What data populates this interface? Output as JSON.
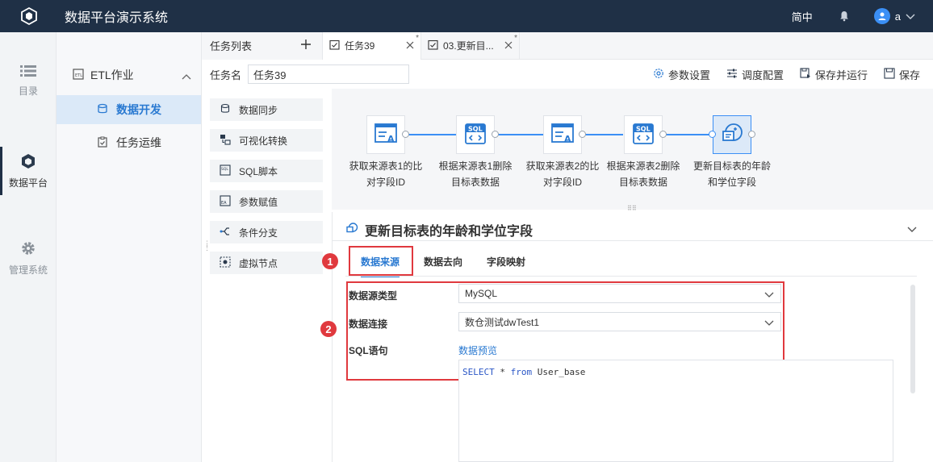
{
  "app": {
    "title": "数据平台演示系统",
    "language": "简中",
    "user": "a"
  },
  "leftnav": [
    {
      "label": "目录",
      "icon": "list-icon"
    },
    {
      "label": "数据平台",
      "icon": "cubes-icon"
    },
    {
      "label": "管理系统",
      "icon": "gear-icon"
    }
  ],
  "secondnav": {
    "group_label": "ETL作业",
    "items": [
      {
        "label": "数据开发",
        "active": true
      },
      {
        "label": "任务运维"
      }
    ]
  },
  "tabs": {
    "list_label": "任务列表",
    "items": [
      {
        "label": "任务39",
        "active": true,
        "modified": "*"
      },
      {
        "label": "03.更新目...",
        "modified": "*"
      }
    ]
  },
  "toolbar": {
    "name_label": "任务名",
    "name_value": "任务39",
    "actions": [
      "参数设置",
      "调度配置",
      "保存并运行",
      "保存"
    ]
  },
  "palette": [
    "数据同步",
    "可视化转换",
    "SQL脚本",
    "参数赋值",
    "条件分支",
    "虚拟节点"
  ],
  "flow": {
    "nodes": [
      {
        "label_l1": "获取来源表1的比",
        "label_l2": "对字段ID"
      },
      {
        "label_l1": "根据来源表1删除",
        "label_l2": "目标表数据"
      },
      {
        "label_l1": "获取来源表2的比",
        "label_l2": "对字段ID"
      },
      {
        "label_l1": "根据来源表2删除",
        "label_l2": "目标表数据"
      },
      {
        "label_l1": "更新目标表的年龄",
        "label_l2": "和学位字段"
      }
    ]
  },
  "detail": {
    "title": "更新目标表的年龄和学位字段",
    "tabs": [
      "数据来源",
      "数据去向",
      "字段映射"
    ],
    "fields": {
      "source_type_label": "数据源类型",
      "source_type_value": "MySQL",
      "connection_label": "数据连接",
      "connection_value": "数仓测试dwTest1",
      "sql_label": "SQL语句",
      "preview_link": "数据预览",
      "sql": {
        "kw1": "SELECT",
        "star": " * ",
        "kw2": "from",
        "table": " User_base"
      }
    },
    "badges": [
      "1",
      "2"
    ]
  },
  "colors": {
    "accent": "#2979d1",
    "topbar": "#1f3046",
    "highlight": "#e0393e"
  }
}
